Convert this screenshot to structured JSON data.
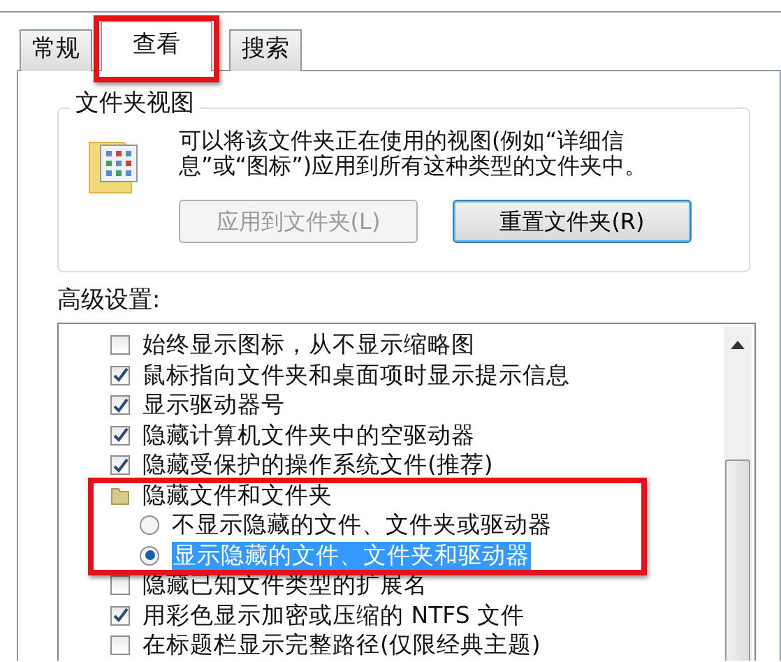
{
  "tabs": [
    {
      "label": "常规",
      "selected": false
    },
    {
      "label": "查看",
      "selected": true
    },
    {
      "label": "搜索",
      "selected": false
    }
  ],
  "folder_views": {
    "title": "文件夹视图",
    "description": "可以将该文件夹正在使用的视图(例如“详细信息”或“图标”)应用到所有这种类型的文件夹中。",
    "buttons": [
      {
        "label": "应用到文件夹(L)",
        "disabled": true
      },
      {
        "label": "重置文件夹(R)",
        "disabled": false
      }
    ]
  },
  "advanced": {
    "title": "高级设置:",
    "items": [
      {
        "kind": "checkbox",
        "label": "始终显示图标，从不显示缩略图",
        "checked": false
      },
      {
        "kind": "checkbox",
        "label": "鼠标指向文件夹和桌面项时显示提示信息",
        "checked": true
      },
      {
        "kind": "checkbox",
        "label": "显示驱动器号",
        "checked": true
      },
      {
        "kind": "checkbox",
        "label": "隐藏计算机文件夹中的空驱动器",
        "checked": true
      },
      {
        "kind": "checkbox",
        "label": "隐藏受保护的操作系统文件(推荐)",
        "checked": true
      },
      {
        "kind": "group",
        "label": "隐藏文件和文件夹"
      },
      {
        "kind": "radio",
        "label": "不显示隐藏的文件、文件夹或驱动器",
        "selected": false
      },
      {
        "kind": "radio",
        "label": "显示隐藏的文件、文件夹和驱动器",
        "selected": true
      },
      {
        "kind": "checkbox",
        "label": "隐藏已知文件类型的扩展名",
        "checked": false
      },
      {
        "kind": "checkbox",
        "label": "用彩色显示加密或压缩的 NTFS 文件",
        "checked": true
      },
      {
        "kind": "checkbox",
        "label": "在标题栏显示完整路径(仅限经典主题)",
        "checked": false
      }
    ]
  }
}
